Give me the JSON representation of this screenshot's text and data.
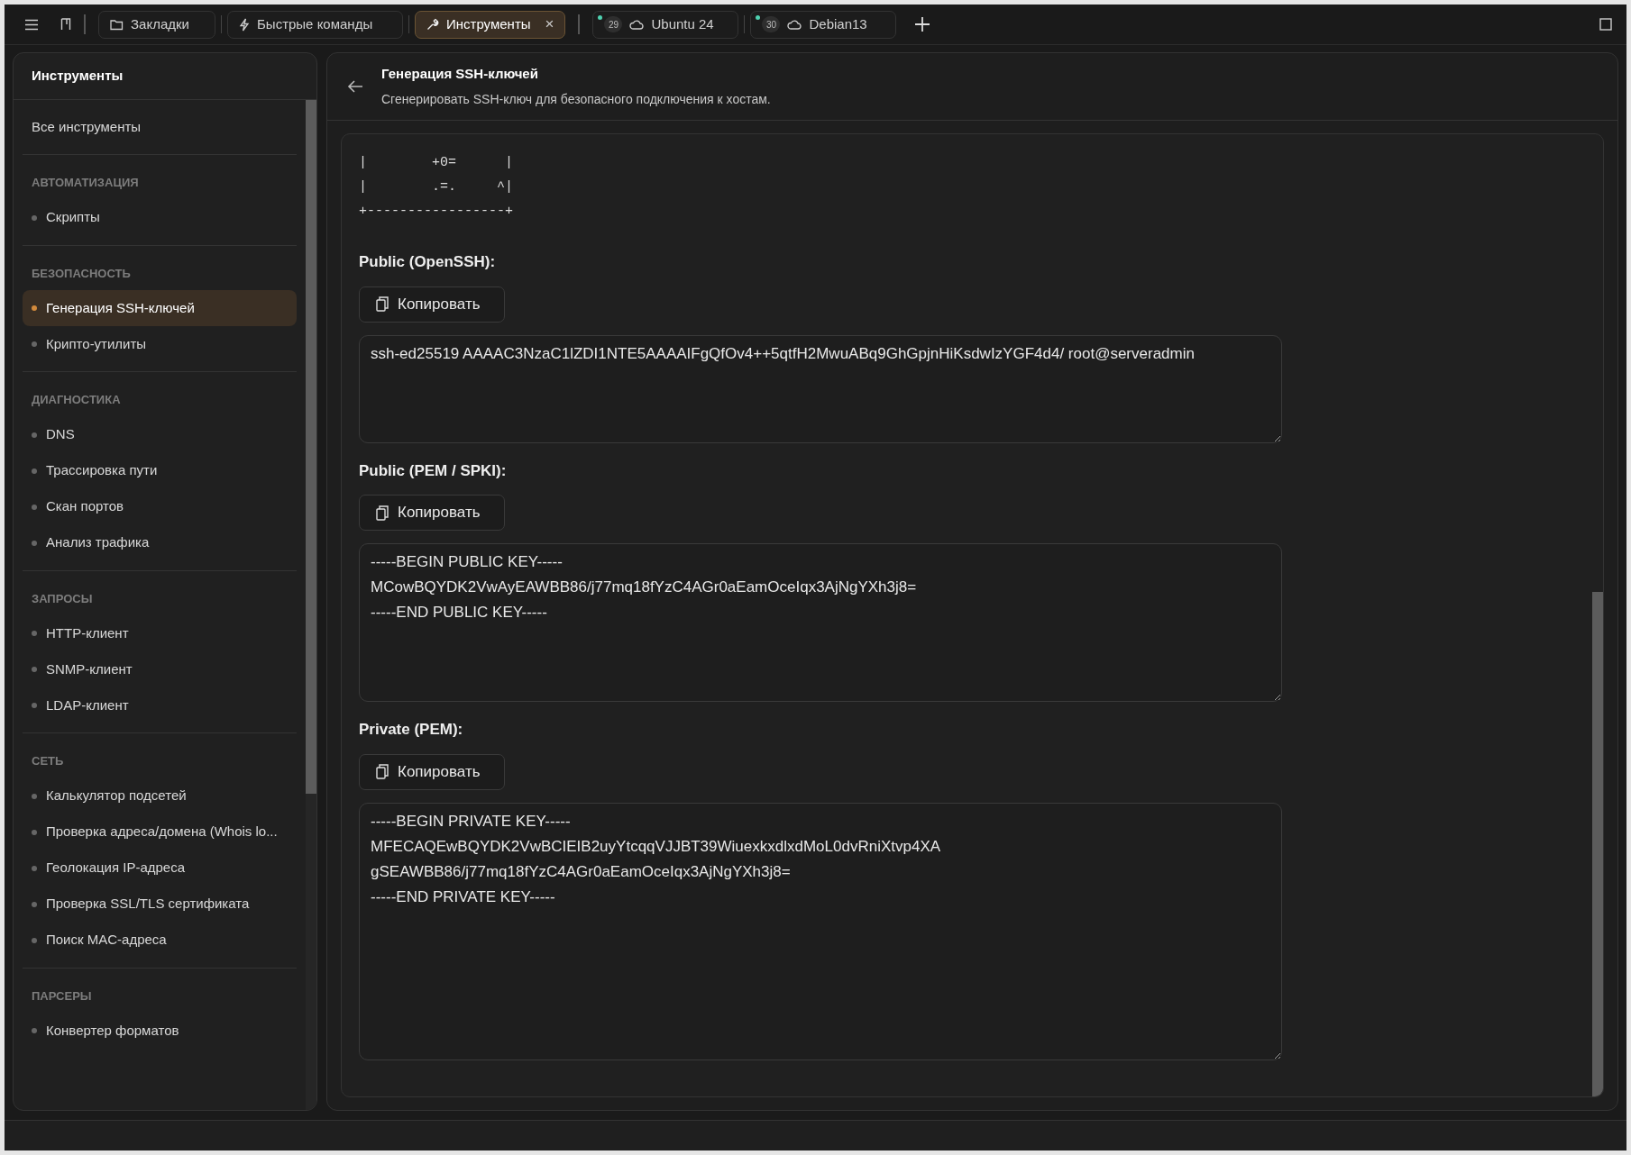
{
  "tabs": [
    {
      "kind": "folder",
      "label": "Закладки",
      "selected": false
    },
    {
      "kind": "bolt",
      "label": "Быстрые команды",
      "selected": false
    },
    {
      "kind": "tool",
      "label": "Инструменты",
      "selected": true,
      "close": "×"
    },
    {
      "kind": "host",
      "label": "Ubuntu 24",
      "count": "29",
      "color": "#4fd1b0",
      "selected": false
    },
    {
      "kind": "host",
      "label": "Debian13",
      "count": "30",
      "color": "#4fd1b0",
      "selected": false
    }
  ],
  "sidebar": {
    "title": "Инструменты",
    "groups": [
      {
        "items": [
          {
            "label": "Все инструменты",
            "selected": false
          }
        ]
      },
      {
        "title": "АВТОМАТИЗАЦИЯ",
        "items": [
          {
            "label": "Скрипты",
            "selected": false
          }
        ]
      },
      {
        "title": "БЕЗОПАСНОСТЬ",
        "items": [
          {
            "label": "Генерация SSH-ключей",
            "selected": true
          },
          {
            "label": "Крипто-утилиты",
            "selected": false
          }
        ]
      },
      {
        "title": "ДИАГНОСТИКА",
        "items": [
          {
            "label": "DNS",
            "selected": false
          },
          {
            "label": "Трассировка пути",
            "selected": false
          },
          {
            "label": "Скан портов",
            "selected": false
          },
          {
            "label": "Анализ трафика",
            "selected": false
          }
        ]
      },
      {
        "title": "ЗАПРОСЫ",
        "items": [
          {
            "label": "HTTP-клиент",
            "selected": false
          },
          {
            "label": "SNMP-клиент",
            "selected": false
          },
          {
            "label": "LDAP-клиент",
            "selected": false
          }
        ]
      },
      {
        "title": "СЕТЬ",
        "items": [
          {
            "label": "Калькулятор подсетей",
            "selected": false
          },
          {
            "label": "Проверка адреса/домена (Whois lo...",
            "selected": false
          },
          {
            "label": "Геолокация IP-адреса",
            "selected": false
          },
          {
            "label": "Проверка SSL/TLS сертификата",
            "selected": false
          },
          {
            "label": "Поиск MAC-адреса",
            "selected": false
          }
        ]
      },
      {
        "title": "ПАРСЕРЫ",
        "items": [
          {
            "label": "Конвертер форматов",
            "selected": false
          }
        ]
      }
    ]
  },
  "page": {
    "title": "Генерация SSH-ключей",
    "subtitle": "Сгенерировать SSH-ключ для безопасного подключения к хостам."
  },
  "randomart": [
    "|        +0=      |",
    "|        .=.     ^|",
    "+-----------------+"
  ],
  "sections": [
    {
      "label": "Public (OpenSSH):",
      "button": "Копировать",
      "value": "ssh-ed25519 AAAAC3NzaC1lZDI1NTE5AAAAIFgQfOv4++5qtfH2MwuABq9GhGpjnHiKsdwIzYGF4d4/ root@serveradmin"
    },
    {
      "label": "Public (PEM / SPKI):",
      "button": "Копировать",
      "value": "-----BEGIN PUBLIC KEY-----\nMCowBQYDK2VwAyEAWBB86/j77mq18fYzC4AGr0aEamOceIqx3AjNgYXh3j8=\n-----END PUBLIC KEY-----"
    },
    {
      "label": "Private (PEM):",
      "button": "Копировать",
      "value": "-----BEGIN PRIVATE KEY-----\nMFECAQEwBQYDK2VwBCIEIB2uyYtcqqVJJBT39WiuexkxdlxdMoL0dvRniXtvp4XA\ngSEAWBB86/j77mq18fYzC4AGr0aEamOceIqx3AjNgYXh3j8=\n-----END PRIVATE KEY-----"
    }
  ]
}
